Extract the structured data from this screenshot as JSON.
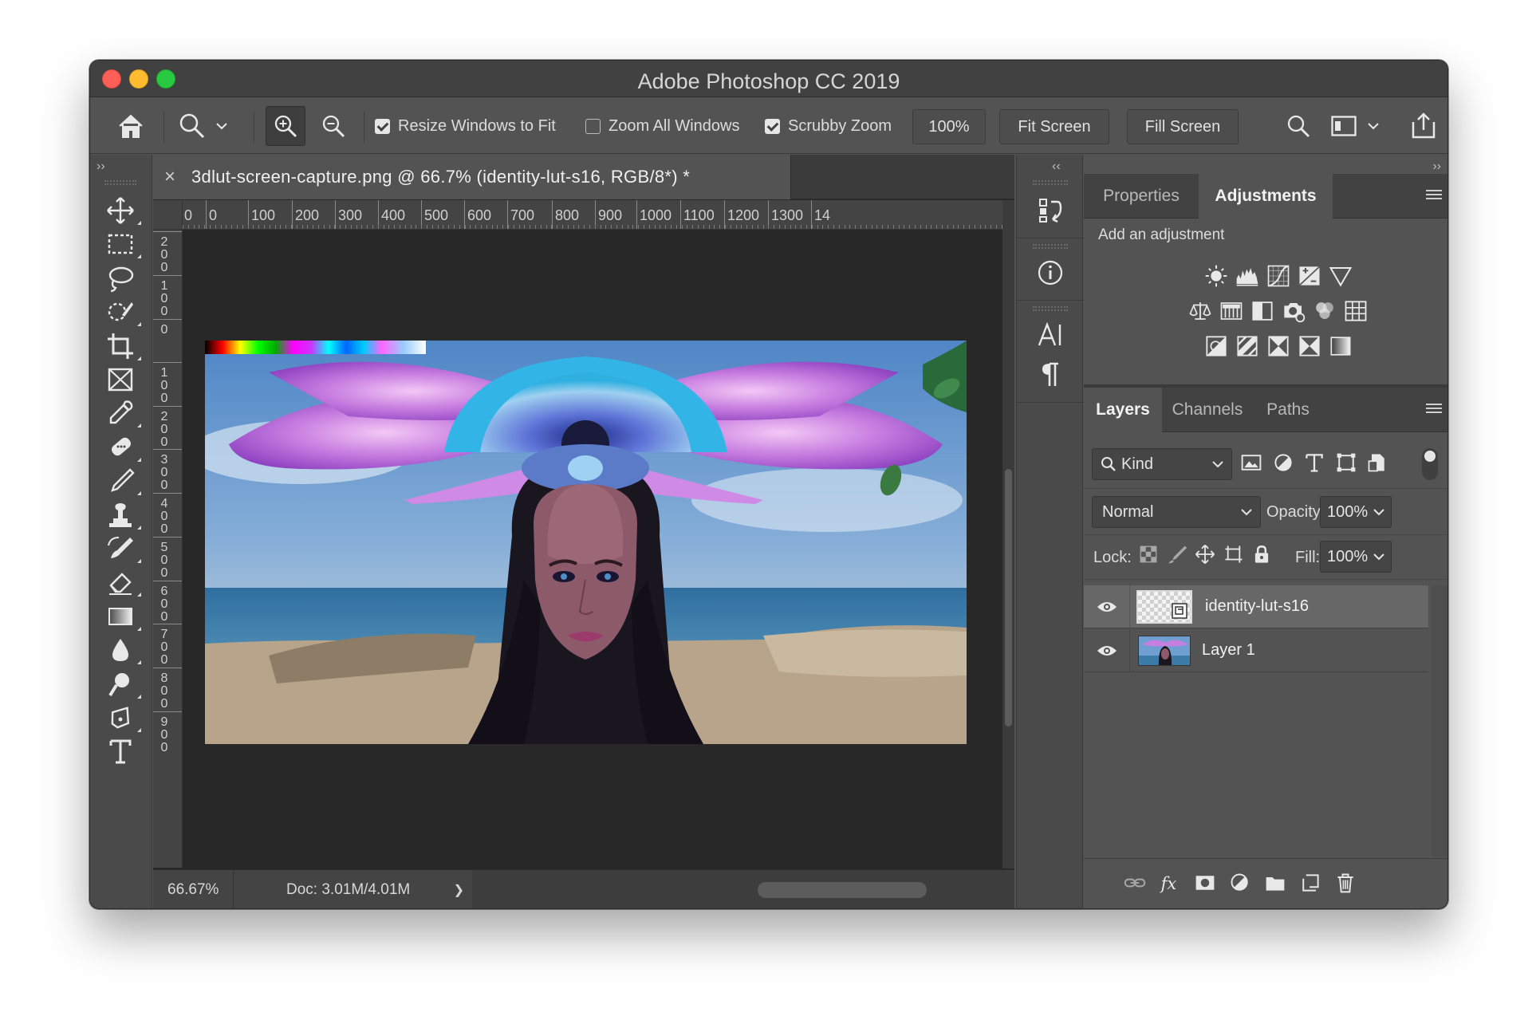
{
  "window": {
    "title": "Adobe Photoshop CC 2019"
  },
  "options": {
    "resize_windows_label": "Resize Windows to Fit",
    "resize_windows_checked": true,
    "zoom_all_label": "Zoom All Windows",
    "zoom_all_checked": false,
    "scrubby_zoom_label": "Scrubby Zoom",
    "scrubby_zoom_checked": true,
    "zoom_value": "100%",
    "fit_screen_label": "Fit Screen",
    "fill_screen_label": "Fill Screen"
  },
  "document": {
    "tab_title": "3dlut-screen-capture.png @ 66.7% (identity-lut-s16, RGB/8*) *",
    "close_glyph": "×",
    "ruler_h": [
      "0",
      "0",
      "100",
      "200",
      "300",
      "400",
      "500",
      "600",
      "700",
      "800",
      "900",
      "1000",
      "1100",
      "1200",
      "1300",
      "14"
    ],
    "ruler_v": [
      "2\n0\n0",
      "1\n0\n0",
      "0",
      "1\n0\n0",
      "2\n0\n0",
      "3\n0\n0",
      "4\n0\n0",
      "5\n0\n0",
      "6\n0\n0",
      "7\n0\n0",
      "8\n0\n0",
      "9\n0\n0"
    ]
  },
  "status": {
    "zoom": "66.67%",
    "doc_size": "Doc: 3.01M/4.01M",
    "arrow": "❯"
  },
  "panels": {
    "collapse_left": "››",
    "collapse_mid": "‹‹",
    "collapse_right": "››",
    "properties_tab": "Properties",
    "adjustments_tab": "Adjustments",
    "add_adjustment": "Add an adjustment",
    "adjustment_icons": [
      "brightness-contrast-icon",
      "levels-icon",
      "curves-icon",
      "exposure-icon",
      "vibrance-icon",
      "hue-saturation-icon",
      "color-balance-icon",
      "black-white-icon",
      "photo-filter-icon",
      "channel-mixer-icon",
      "color-lookup-icon",
      "invert-icon",
      "posterize-icon",
      "threshold-icon",
      "selective-color-icon",
      "gradient-map-icon"
    ]
  },
  "layers": {
    "tabs": [
      "Layers",
      "Channels",
      "Paths"
    ],
    "kind_label": "Kind",
    "blend_mode": "Normal",
    "opacity_label": "Opacity:",
    "opacity_value": "100%",
    "lock_label": "Lock:",
    "fill_label": "Fill:",
    "fill_value": "100%",
    "items": [
      {
        "name": "identity-lut-s16",
        "selected": true,
        "visible": true
      },
      {
        "name": "Layer 1",
        "selected": false,
        "visible": true
      }
    ],
    "footer_icons": [
      "link-layers-icon",
      "fx-icon",
      "add-mask-icon",
      "new-adjustment-icon",
      "new-group-icon",
      "new-layer-icon",
      "delete-layer-icon"
    ]
  },
  "colors": {
    "accent_red": "#fe5f57",
    "accent_yellow": "#febc2e",
    "accent_green": "#28c840",
    "panel_bg": "#535353",
    "canvas_bg": "#282828"
  }
}
